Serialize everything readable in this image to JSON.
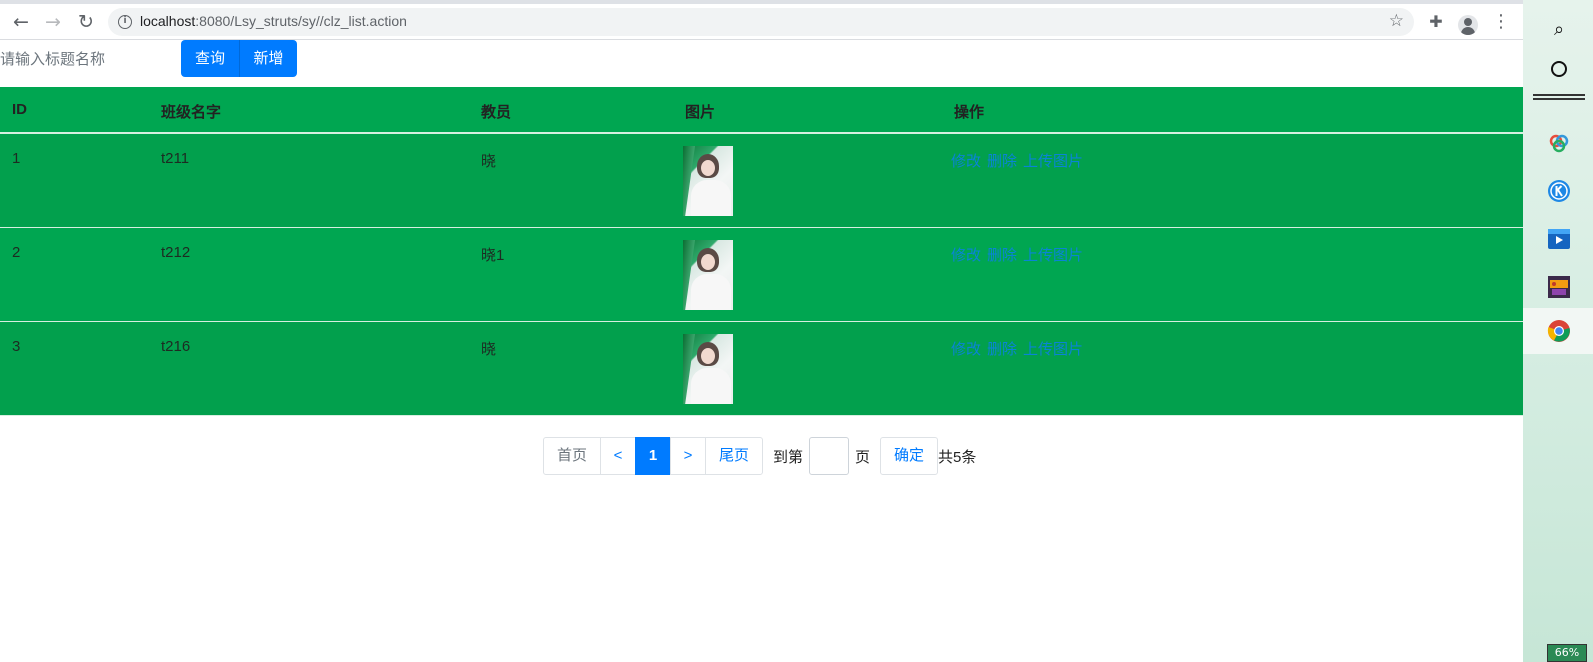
{
  "browser": {
    "url_host": "localhost",
    "url_path": ":8080/Lsy_struts/sy//clz_list.action",
    "back_glyph": "←",
    "forward_glyph": "→",
    "reload_glyph": "↻",
    "star_glyph": "☆",
    "extensions_glyph": "✚",
    "menu_glyph": "⋮"
  },
  "search": {
    "placeholder": "请输入标题名称",
    "query_label": "查询",
    "add_label": "新增"
  },
  "table": {
    "headers": [
      "ID",
      "班级名字",
      "教员",
      "图片",
      "操作"
    ],
    "rows": [
      {
        "id": "1",
        "name": "t211",
        "teacher": "晓",
        "ops": [
          "修改",
          "删除",
          "上传图片"
        ]
      },
      {
        "id": "2",
        "name": "t212",
        "teacher": "晓1",
        "ops": [
          "修改",
          "删除",
          "上传图片"
        ]
      },
      {
        "id": "3",
        "name": "t216",
        "teacher": "晓",
        "ops": [
          "修改",
          "删除",
          "上传图片"
        ]
      }
    ]
  },
  "pager": {
    "first": "首页",
    "prev": "<",
    "current": "1",
    "next": ">",
    "last": "尾页",
    "goto_prefix": "到第",
    "goto_suffix": "页",
    "confirm": "确定",
    "total": "共5条"
  },
  "dock": {
    "search_glyph": "⌕",
    "battery": "66%"
  },
  "colors": {
    "table_green": "#00a651",
    "primary_blue": "#007bff",
    "link_blue": "#0a84d6"
  }
}
